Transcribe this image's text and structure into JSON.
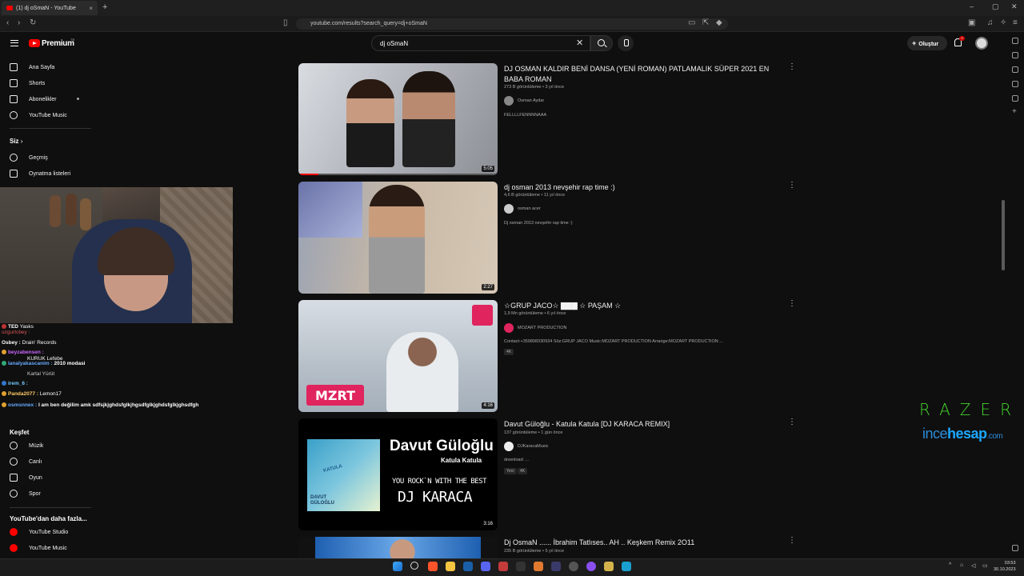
{
  "browser": {
    "tab_title": "(1) dj oSmaN - YouTube",
    "tab_close": "×",
    "new_tab": "+",
    "url": "youtube.com/results?search_query=dj+oSmaN",
    "window_controls": [
      "–",
      "▢",
      "✕"
    ]
  },
  "header": {
    "brand": "Premium",
    "brand_suffix": "TR",
    "search_value": "dj oSmaN",
    "search_clear": "✕",
    "create_label": "Oluştur",
    "notification_count": "9"
  },
  "sidebar": {
    "items": [
      {
        "label": "Ana Sayfa"
      },
      {
        "label": "Shorts"
      },
      {
        "label": "Abonelikler"
      },
      {
        "label": "YouTube Music"
      }
    ],
    "you_heading": "Siz",
    "you_items": [
      {
        "label": "Geçmiş"
      },
      {
        "label": "Oynatma listeleri"
      }
    ],
    "explore_heading": "Keşfet",
    "explore_items": [
      {
        "label": "Müzik"
      },
      {
        "label": "Canlı"
      },
      {
        "label": "Oyun"
      },
      {
        "label": "Spor"
      }
    ],
    "more_heading": "YouTube'dan daha fazla...",
    "more_items": [
      {
        "label": "YouTube Studio"
      },
      {
        "label": "YouTube Music"
      }
    ]
  },
  "chat": {
    "lines": [
      {
        "user": "TED",
        "text": "Yasks"
      },
      {
        "user": "",
        "text": "ozgurtcbey :"
      },
      {
        "user": "Osbey :",
        "text": "Drain' Records"
      },
      {
        "user": "beyzabensen :",
        "text": ""
      },
      {
        "user": "",
        "text": "KURUK Lefebe"
      },
      {
        "user": "lanalyakascanim :",
        "text": "2010 modasi"
      },
      {
        "user": "",
        "text": "Kartal Yürüt"
      },
      {
        "user": "irem_6 :",
        "text": ""
      },
      {
        "user": "Panda2077 :",
        "text": "Lemon17"
      },
      {
        "user": "osmsnnex :",
        "text": "I am ben değilim amk sdfsjkjghdsfglkjhgsdfglkjghdsfglkjghsdfgh"
      }
    ]
  },
  "results": [
    {
      "title": "DJ OSMAN KALDIR BENİ DANSA (YENİ ROMAN) PATLAMALIK SÜPER 2021 EN BABA ROMAN",
      "meta": "273 B görüntüleme • 3 yıl önce",
      "channel": "Osman Aydar",
      "description": "FELLLLFENNNNAAA",
      "duration": "5:05",
      "progress": 0.1,
      "tags": []
    },
    {
      "title": "dj osman 2013 nevşehir rap time :)",
      "meta": "4,6 B görüntüleme • 11 yıl önce",
      "channel": "osman acer",
      "description": "Dj osman 2013 nevşehir rap time :)",
      "duration": "2:27",
      "tags": []
    },
    {
      "title": "☆GRUP JACO☆ ▇▇▇ ☆ PAŞAM ☆",
      "meta": "1,9 Mn görüntüleme • 6 yıl önce",
      "channel": "MOZART PRODUCTION",
      "description": "Contact:+359898330934 Söz:GRUP JACO Music:MOZART PRODUCTION Arrange:MOZART PRODUCTION ...",
      "duration": "4:16",
      "tags": [
        "4K"
      ],
      "thumb_logo": "MZRT"
    },
    {
      "title": "Davut Güloğlu - Katula Katula [DJ KARACA REMIX]",
      "meta": "137 görüntüleme • 1 gün önce",
      "channel": "DJKaracaMusic",
      "description": "download: ...",
      "duration": "3:16",
      "tags": [
        "Yeni",
        "4K"
      ],
      "thumb_text": {
        "artist": "Davut Güloğlu",
        "song": "Katula Katula",
        "tagline": "YOU ROCK`N WITH THE BEST",
        "dj": "DJ KARACA",
        "cover_top": "KATULA",
        "cover_bottom": "DAVUT GÜLOĞLU"
      }
    },
    {
      "title": "Dj OsmaN ...... İbrahim Tatlıses.. AH .. Keşkem Remix 2O11",
      "meta": "235 B görüntüleme • 5 yıl önce"
    }
  ],
  "watermark": {
    "razer": "RAZER",
    "site_a": "ince",
    "site_b": "hesap",
    "site_c": ".com"
  },
  "taskbar": {
    "time": "03:53",
    "date": "30.10.2023"
  },
  "colors": {
    "youtube_red": "#ff0000",
    "razer_green": "#44d62c",
    "incehesap_blue": "#2c8ad6"
  }
}
